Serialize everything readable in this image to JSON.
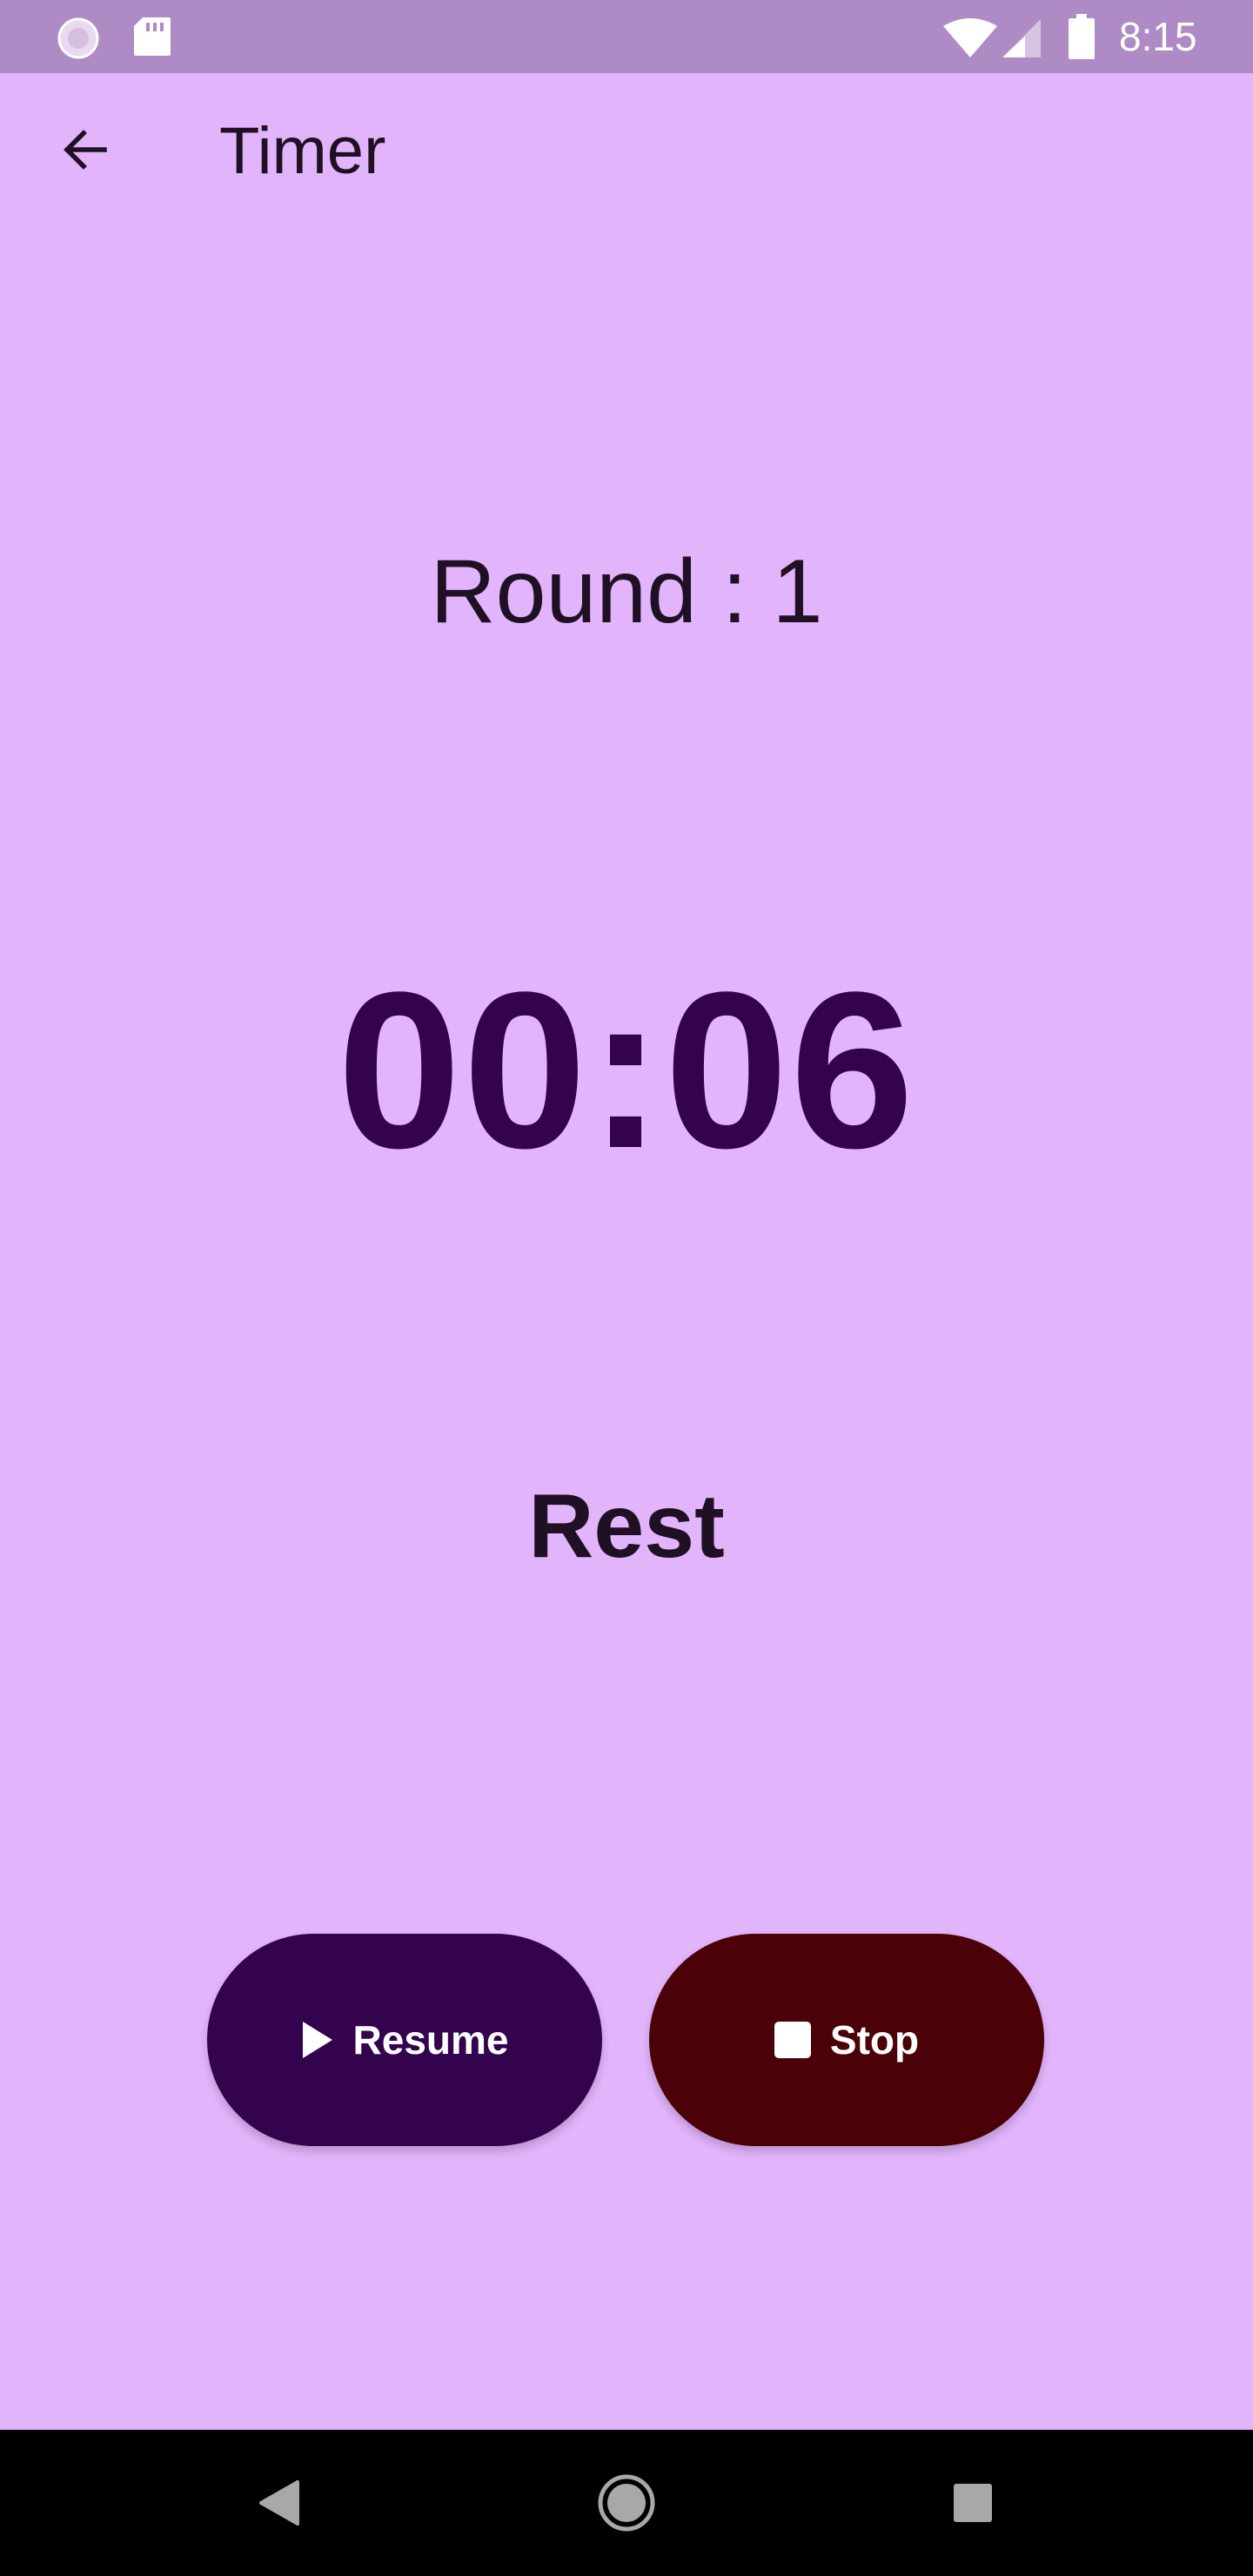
{
  "status_bar": {
    "time": "8:15",
    "icons": [
      "loader-icon",
      "sd-card-icon",
      "wifi-icon",
      "signal-icon",
      "battery-icon"
    ]
  },
  "app_bar": {
    "title": "Timer",
    "back_icon": "arrow-back-icon"
  },
  "timer": {
    "round_label": "Round : 1",
    "time": "00:06",
    "phase": "Rest"
  },
  "buttons": {
    "resume_label": "Resume",
    "resume_icon": "play-icon",
    "stop_label": "Stop",
    "stop_icon": "stop-icon"
  },
  "nav_bar": {
    "icons": [
      "nav-back-icon",
      "nav-home-icon",
      "nav-recents-icon"
    ]
  },
  "colors": {
    "background": "#e2b4fb",
    "status_bar": "#ae8bc4",
    "time_text": "#33034e",
    "resume_button": "#33034e",
    "stop_button": "#4a0208",
    "nav_bar": "#000000"
  }
}
